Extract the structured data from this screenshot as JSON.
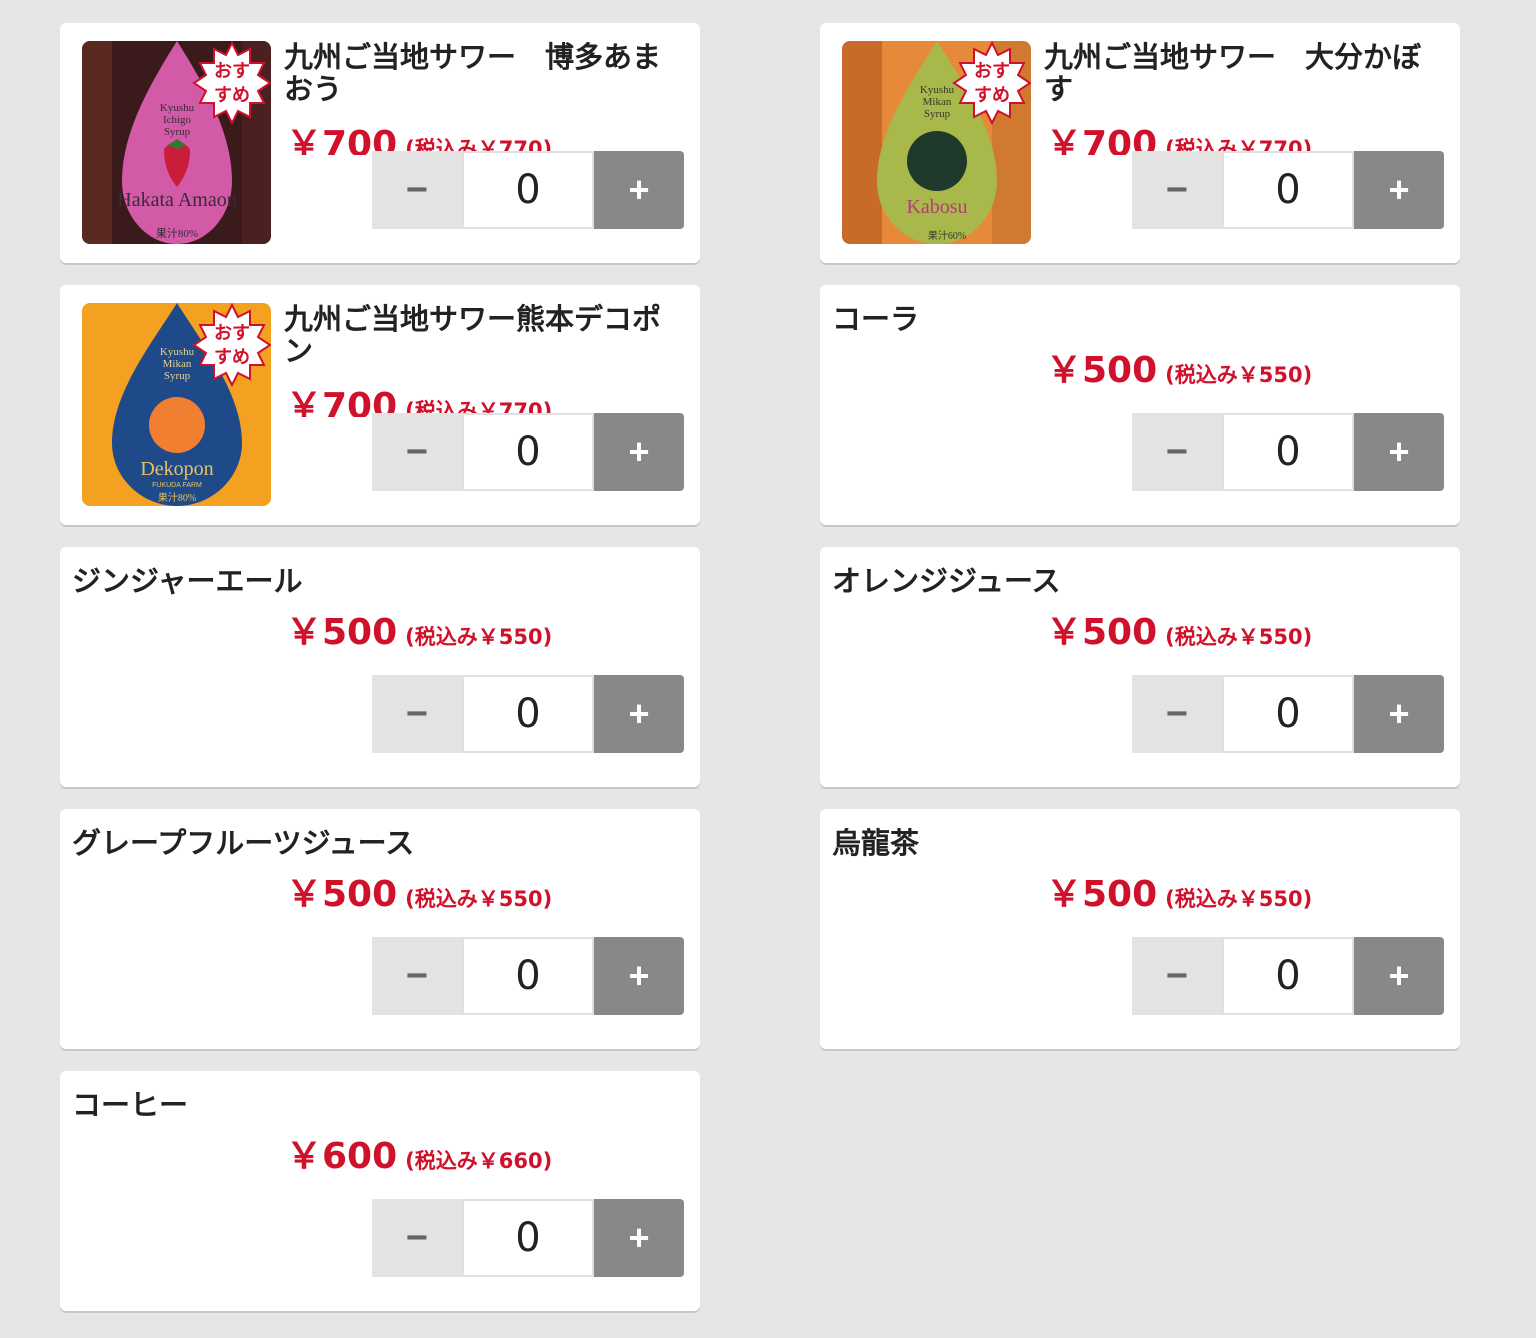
{
  "products": [
    {
      "name": "九州ご当地サワー　博多あまおう",
      "price": "￥700",
      "tax": "(税込み￥770)",
      "qty": "0",
      "badge_line1": "おす",
      "badge_line2": "すめ",
      "label_top": [
        "Kyushu",
        "Ichigo",
        "Syrup"
      ],
      "label_brand": "Hakata Amaou",
      "label_sub": "果汁80%"
    },
    {
      "name": "九州ご当地サワー　大分かぼす",
      "price": "￥700",
      "tax": "(税込み￥770)",
      "qty": "0",
      "badge_line1": "おす",
      "badge_line2": "すめ",
      "label_top": [
        "Kyushu",
        "Mikan",
        "Syrup"
      ],
      "label_brand": "Kabosu",
      "label_sub": "果汁60%"
    },
    {
      "name": "九州ご当地サワー熊本デコポン",
      "price": "￥700",
      "tax": "(税込み￥770)",
      "qty": "0",
      "badge_line1": "おす",
      "badge_line2": "すめ",
      "label_top": [
        "Kyushu",
        "Mikan",
        "Syrup"
      ],
      "label_brand": "Dekopon",
      "label_sub": "果汁80%",
      "label_farm": "FUKUDA FARM"
    },
    {
      "name": "コーラ",
      "price": "￥500",
      "tax": "(税込み￥550)",
      "qty": "0"
    },
    {
      "name": "ジンジャーエール",
      "price": "￥500",
      "tax": "(税込み￥550)",
      "qty": "0"
    },
    {
      "name": "オレンジジュース",
      "price": "￥500",
      "tax": "(税込み￥550)",
      "qty": "0"
    },
    {
      "name": "グレープフルーツジュース",
      "price": "￥500",
      "tax": "(税込み￥550)",
      "qty": "0"
    },
    {
      "name": "烏龍茶",
      "price": "￥500",
      "tax": "(税込み￥550)",
      "qty": "0"
    },
    {
      "name": "コーヒー",
      "price": "￥600",
      "tax": "(税込み￥660)",
      "qty": "0"
    }
  ],
  "controls": {
    "minus": "−",
    "plus": "+"
  },
  "colors": {
    "price": "#d0112b",
    "background": "#e6e6e6",
    "plus_button": "#888888",
    "minus_button": "#e3e3e3"
  }
}
